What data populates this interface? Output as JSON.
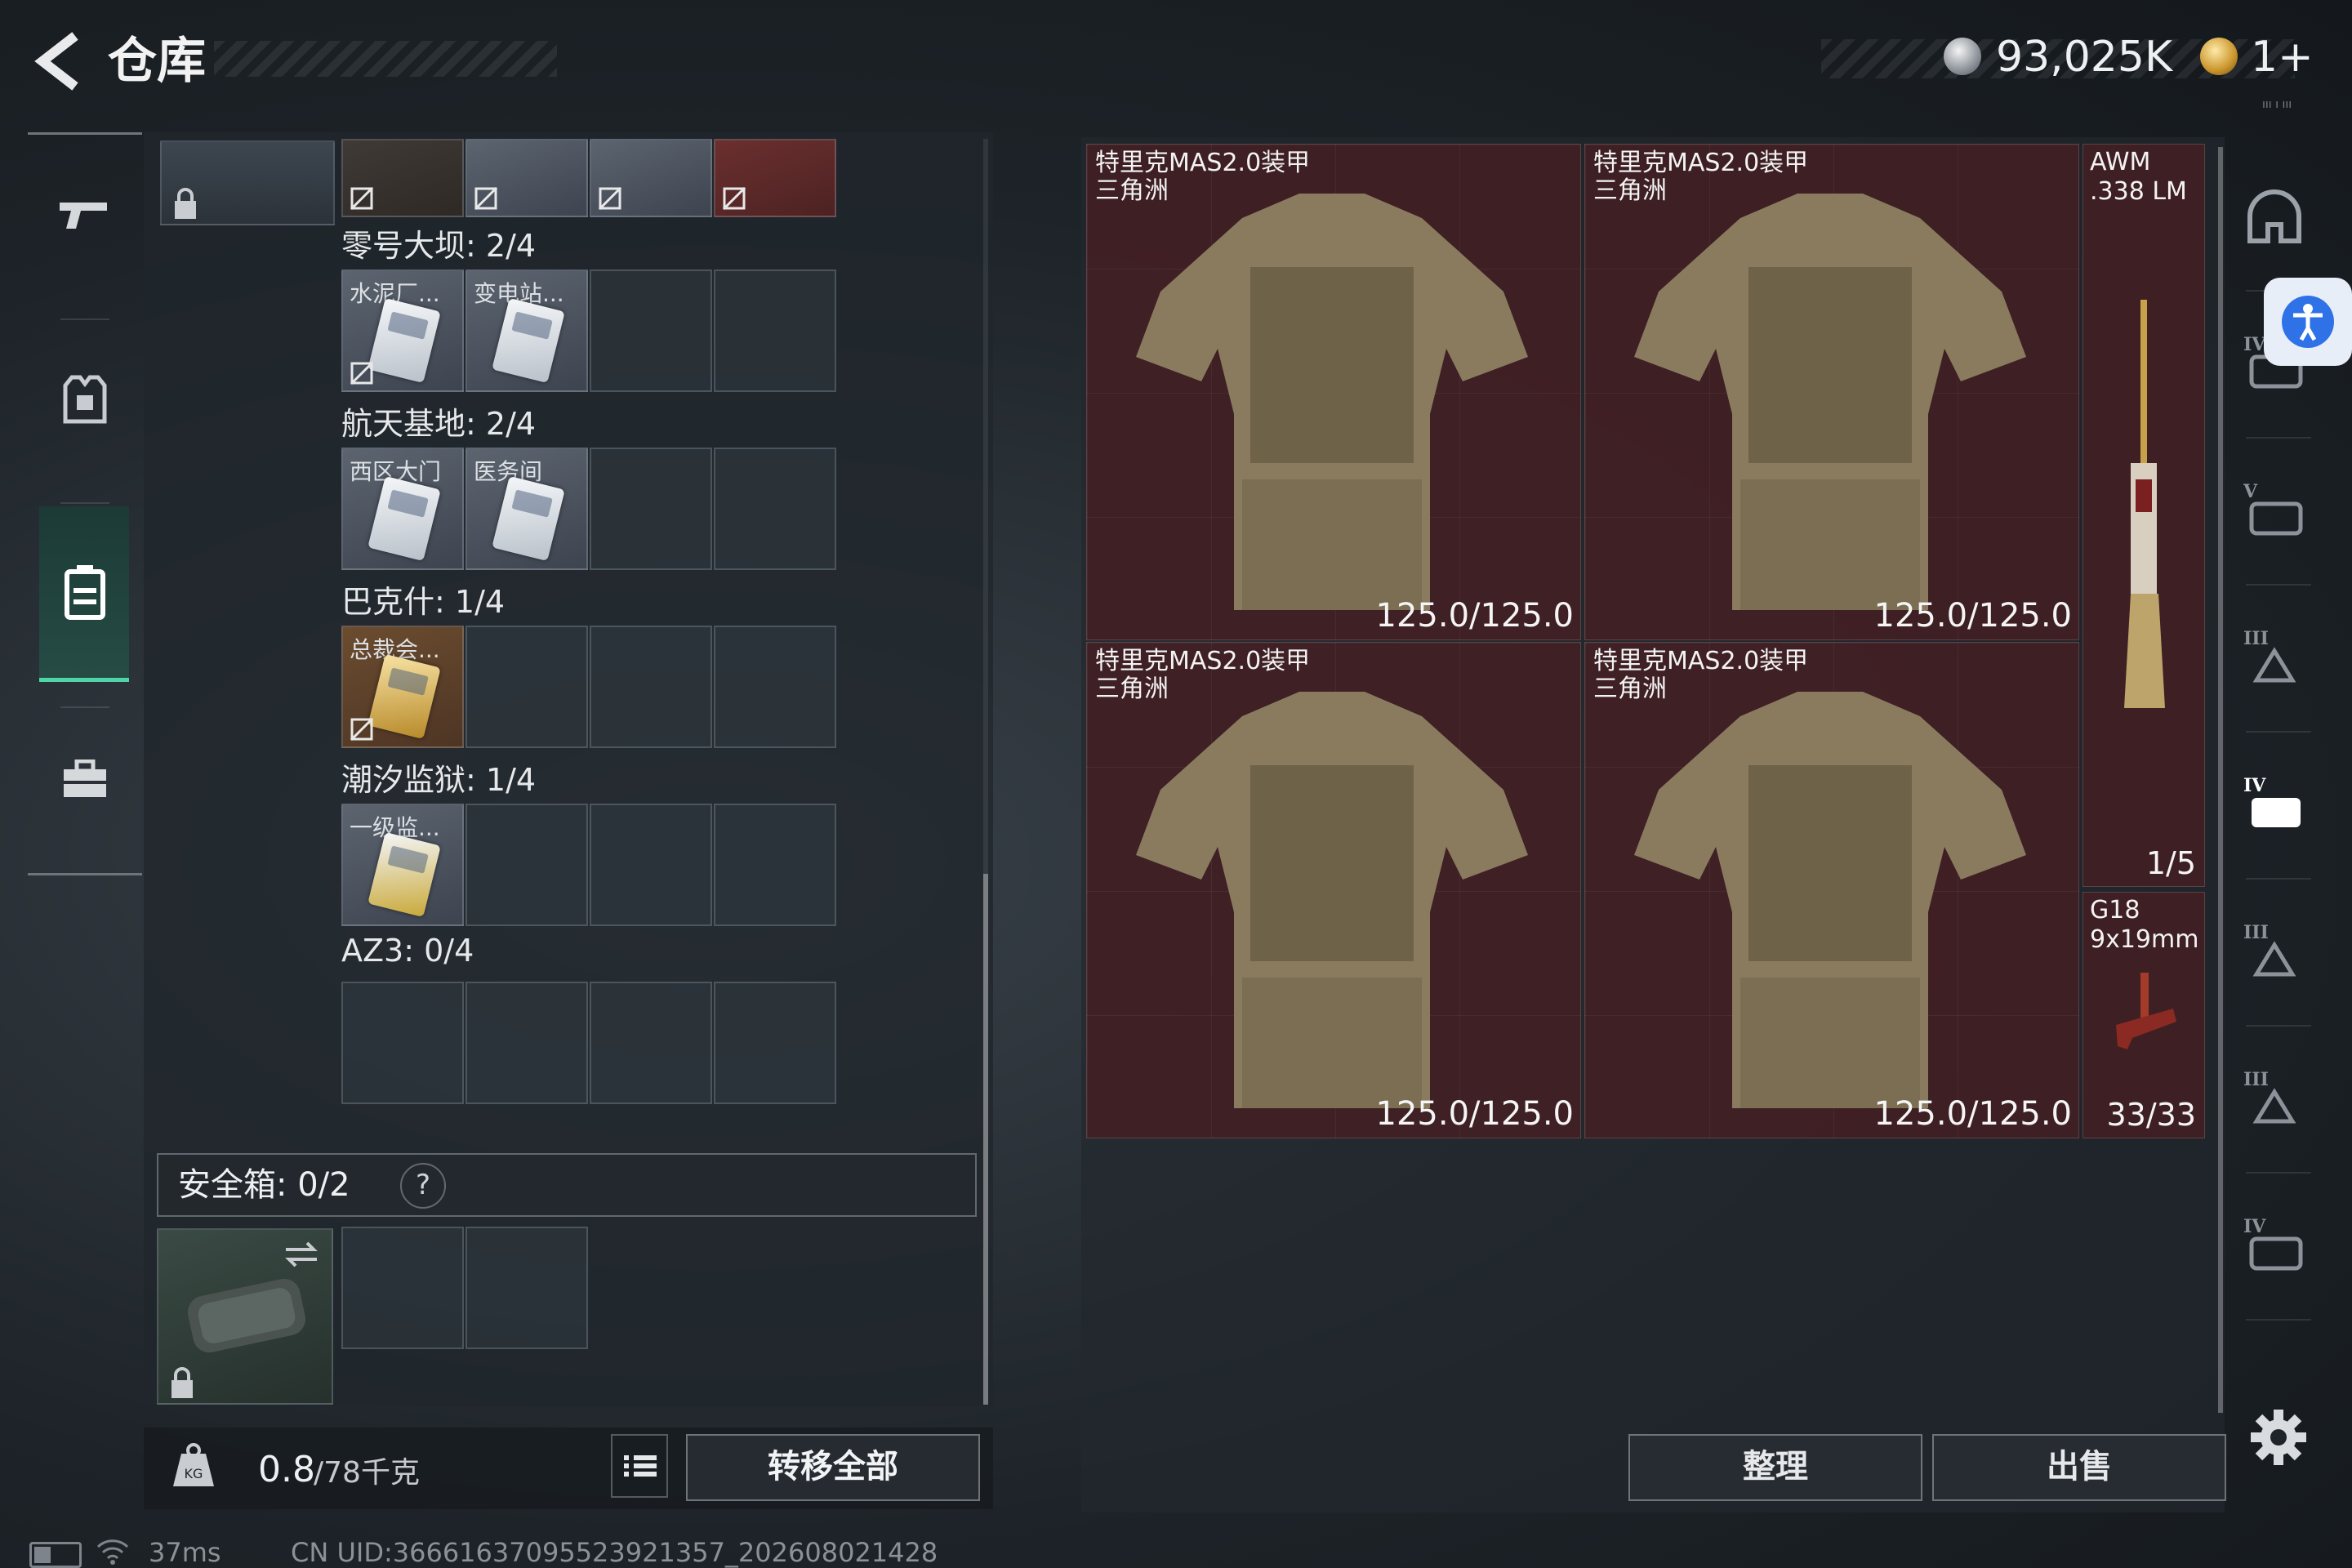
{
  "header": {
    "title": "仓库",
    "currency_silver": "93,025K",
    "currency_gold": "1+",
    "corner_text": "ııı ı ııı"
  },
  "left_nav": {
    "items": [
      {
        "icon": "gun-icon"
      },
      {
        "icon": "vest-icon"
      },
      {
        "icon": "backpack-icon",
        "active": true
      },
      {
        "icon": "toolbox-icon"
      }
    ]
  },
  "inventory": {
    "groups": [
      {
        "name": "零号大坝",
        "count": "2/4",
        "cards": []
      },
      {
        "name": "航天基地",
        "count": "2/4",
        "cards": [
          {
            "name": "水泥厂..."
          },
          {
            "name": "变电站..."
          }
        ]
      },
      {
        "name": "巴克什",
        "count": "1/4",
        "cards": [
          {
            "name": "西区大门"
          },
          {
            "name": "医务间"
          }
        ]
      },
      {
        "name": "潮汐监狱",
        "count": "1/4",
        "cards": [
          {
            "name": "总裁会..."
          }
        ]
      },
      {
        "name": "AZ3",
        "count": "0/4",
        "cards": [
          {
            "name": "一级监..."
          }
        ]
      }
    ],
    "safe_box": {
      "label": "安全箱:",
      "count": "0/2",
      "help": "?"
    },
    "weight": {
      "current": "0.8",
      "max": "/78千克",
      "kg": "KG"
    },
    "transfer_all": "转移全部"
  },
  "container": {
    "armors": [
      {
        "name": "特里克MAS2.0装甲",
        "sub": "三角洲",
        "durability": "125.0/125.0"
      },
      {
        "name": "特里克MAS2.0装甲",
        "sub": "三角洲",
        "durability": "125.0/125.0"
      },
      {
        "name": "特里克MAS2.0装甲",
        "sub": "三角洲",
        "durability": "125.0/125.0"
      },
      {
        "name": "特里克MAS2.0装甲",
        "sub": "三角洲",
        "durability": "125.0/125.0"
      }
    ],
    "weapons": [
      {
        "name": "AWM",
        "sub": ".338 LM",
        "count": "1/5"
      },
      {
        "name": "G18",
        "sub": "9x19mm",
        "count": "33/33"
      }
    ],
    "sort_label": "整理",
    "sell_label": "出售"
  },
  "right_nav": {
    "items": [
      {
        "icon": "helmet-icon",
        "badge": ""
      },
      {
        "icon": "vest-tier-icon",
        "badge": "IV"
      },
      {
        "icon": "vest-tier-icon",
        "badge": "V"
      },
      {
        "icon": "vest-tier-icon",
        "badge": "III"
      },
      {
        "icon": "vest-tier-icon",
        "badge": "IV"
      },
      {
        "icon": "vest-tier-icon",
        "badge": "III"
      },
      {
        "icon": "vest-tier-icon",
        "badge": "III"
      },
      {
        "icon": "vest-tier-icon",
        "badge": "IV"
      }
    ]
  },
  "status": {
    "ping": "37ms",
    "uid": "CN UID:3666163709552392135​7_202608021428"
  }
}
